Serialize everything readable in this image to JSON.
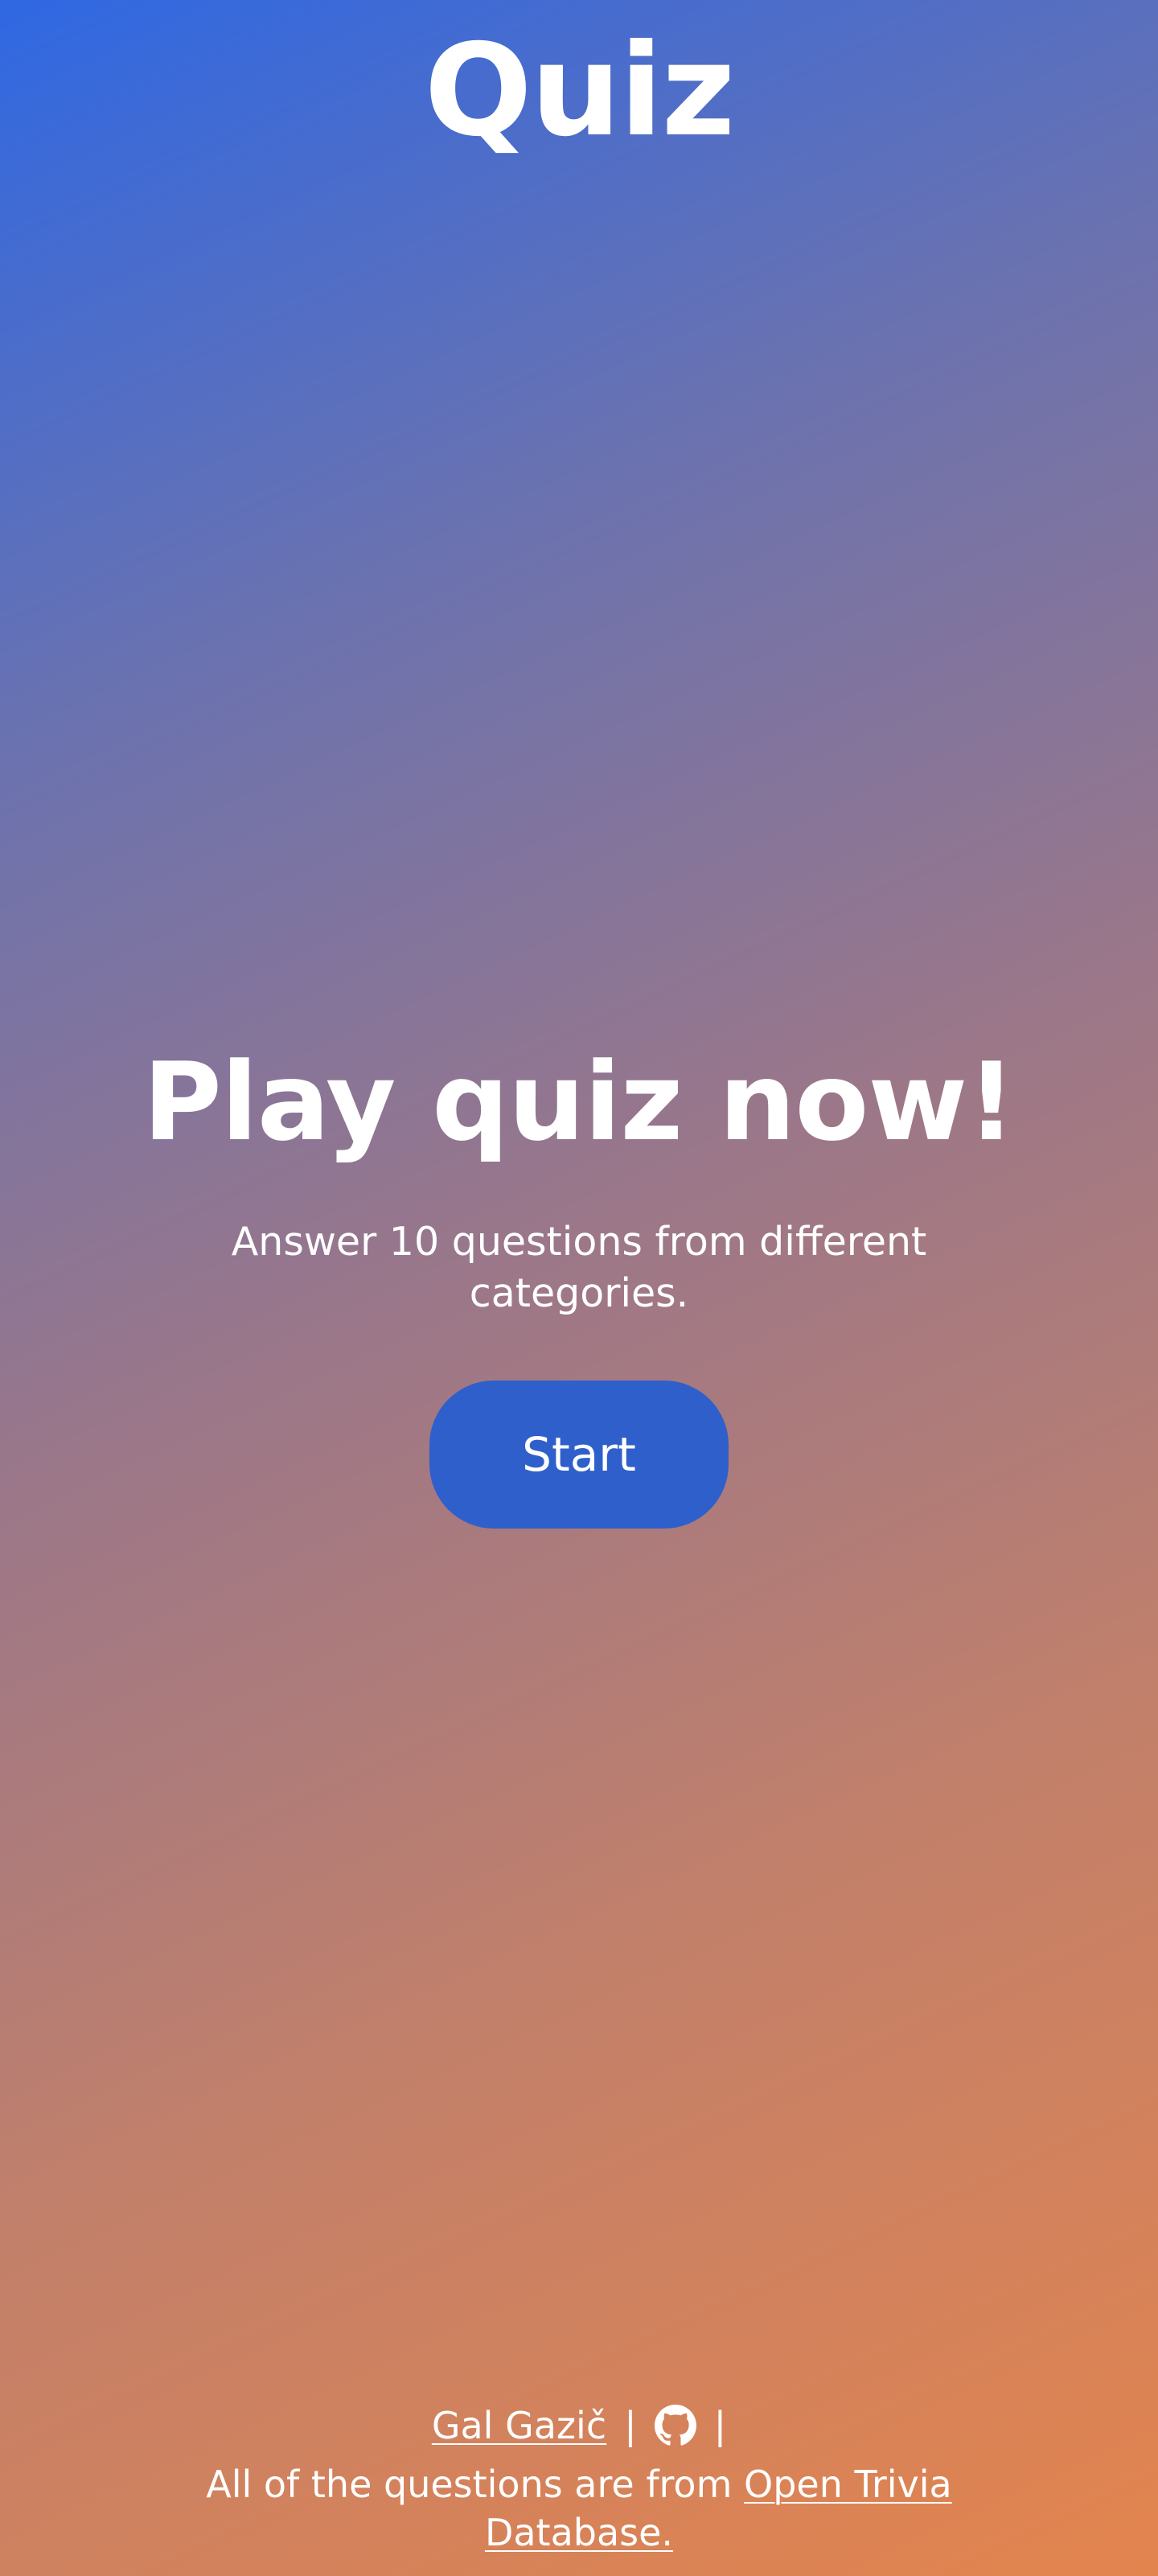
{
  "header": {
    "title": "Quiz"
  },
  "hero": {
    "title": "Play quiz now!",
    "subtitle": "Answer 10 questions from different categories.",
    "start_label": "Start"
  },
  "footer": {
    "author": "Gal Gazič",
    "separator": "|",
    "credit_prefix": "All of the questions are from ",
    "credit_link": "Open Trivia Database.",
    "github_icon": "github-icon"
  },
  "colors": {
    "gradient_start": "#2f68e3",
    "gradient_end": "#e3844e",
    "button": "#2f5fca",
    "text": "#ffffff"
  }
}
